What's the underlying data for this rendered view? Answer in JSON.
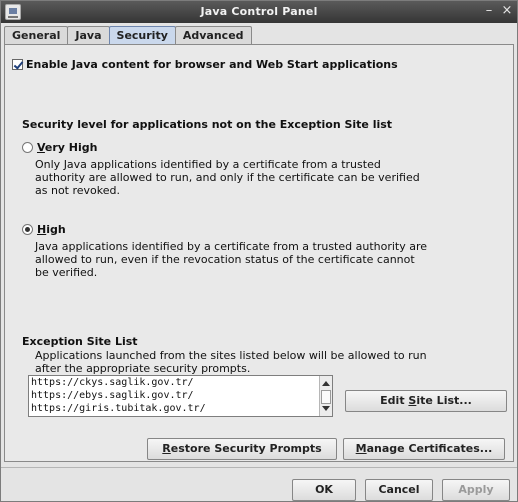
{
  "window": {
    "title": "Java Control Panel",
    "minimize_glyph": "–",
    "close_glyph": "×"
  },
  "tabs": [
    "General",
    "Java",
    "Security",
    "Advanced"
  ],
  "active_tab": "Security",
  "enable_java": {
    "label": "Enable Java content for browser and Web Start applications",
    "checked": true
  },
  "security_level": {
    "heading": "Security level for applications not on the Exception Site list",
    "very_high": {
      "mnemonic": "V",
      "label_rest": "ery High",
      "selected": false,
      "desc": [
        "Only Java applications identified by a certificate from a trusted",
        "authority are allowed to run, and only if the certificate can be verified",
        "as not revoked."
      ]
    },
    "high": {
      "mnemonic": "H",
      "label_rest": "igh",
      "selected": true,
      "desc": [
        "Java applications identified by a certificate from a trusted authority are",
        "allowed to run, even if the revocation status of the certificate cannot",
        "be verified."
      ]
    }
  },
  "exception_sites": {
    "heading": "Exception Site List",
    "desc": [
      "Applications launched from the sites listed below will be allowed to run",
      "after the appropriate security prompts."
    ],
    "sites": [
      "https://ckys.saglik.gov.tr/",
      "https://ebys.saglik.gov.tr/",
      "https://giris.tubitak.gov.tr/"
    ],
    "edit_button": {
      "pre": "Edit ",
      "mnemonic": "S",
      "post": "ite List..."
    }
  },
  "buttons": {
    "restore": {
      "mnemonic": "R",
      "rest": "estore Security Prompts"
    },
    "manage": {
      "mnemonic": "M",
      "rest": "anage Certificates..."
    }
  },
  "footer": {
    "ok": "OK",
    "cancel": "Cancel",
    "apply": "Apply",
    "apply_enabled": false
  }
}
